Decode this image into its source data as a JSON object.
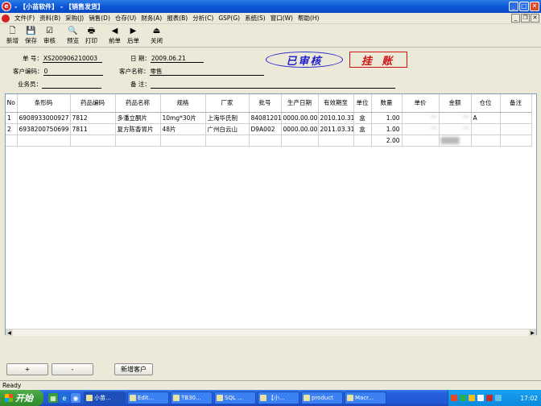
{
  "window": {
    "title": "- 【小苗软件】 - 【销售发货】"
  },
  "menu": [
    "文件(F)",
    "资料(B)",
    "采购(J)",
    "销售(D)",
    "仓存(U)",
    "财务(A)",
    "报表(B)",
    "分析(C)",
    "GSP(G)",
    "系统(S)",
    "窗口(W)",
    "帮助(H)"
  ],
  "toolbar": [
    {
      "name": "new",
      "label": "新增",
      "icon": "🗋"
    },
    {
      "name": "save",
      "label": "保存",
      "icon": "💾"
    },
    {
      "name": "review",
      "label": "审核",
      "icon": "☑"
    },
    {
      "name": "preview",
      "label": "预览",
      "icon": "🔍"
    },
    {
      "name": "print",
      "label": "打印",
      "icon": "🖶"
    },
    {
      "name": "prev",
      "label": "前单",
      "icon": "◀"
    },
    {
      "name": "next",
      "label": "后单",
      "icon": "▶"
    },
    {
      "name": "close",
      "label": "关闭",
      "icon": "⏏"
    }
  ],
  "form": {
    "order_no_label": "单 号：",
    "order_no": "XS200906210003",
    "date_label": "日 期：",
    "date": "2009.06.21",
    "cust_code_label": "客户编码：",
    "cust_code": "0",
    "cust_name_label": "客户名称：",
    "cust_name": "零售",
    "salesman_label": "业务员：",
    "salesman": "",
    "remark_label": "备 注：",
    "remark": ""
  },
  "stamps": {
    "approved": "已审核",
    "pending": "挂 账"
  },
  "grid": {
    "columns": [
      "No",
      "条形码",
      "药品编码",
      "药品名称",
      "规格",
      "厂家",
      "批号",
      "生产日期",
      "有效期至",
      "单位",
      "数量",
      "单价",
      "金额",
      "仓位",
      "备注"
    ],
    "rows": [
      [
        "1",
        "6908933000927",
        "7812",
        "多潘立酮片",
        "10mg*30片",
        "上海华氏制",
        "84081201",
        "0000.00.00",
        "2010.10.31",
        "盒",
        "1.00",
        "**",
        "**",
        "A",
        ""
      ],
      [
        "2",
        "6938200750699",
        "7811",
        "复方陈香胃片",
        "48片",
        "广州白云山",
        "D9A002",
        "0000.00.00",
        "2011.03.31",
        "盒",
        "1.00",
        "**",
        "**",
        "",
        ""
      ]
    ],
    "total_qty": "2.00"
  },
  "buttons": {
    "add": "+",
    "remove": "-",
    "new_customer": "新增客户"
  },
  "status": "Ready",
  "taskbar": {
    "start": "开始",
    "tasks": [
      "小苗...",
      "Edit...",
      "TB30...",
      "SQL ...",
      "【小...",
      "product",
      "Macr..."
    ],
    "clock": "17:02"
  }
}
